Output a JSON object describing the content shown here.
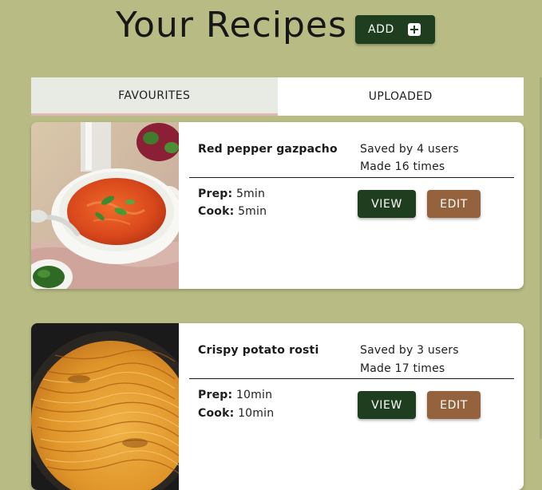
{
  "header": {
    "title": "Your Recipes",
    "add_label": "ADD",
    "add_icon": "plus-square-icon"
  },
  "tabs": [
    {
      "label": "FAVOURITES",
      "active": true
    },
    {
      "label": "UPLOADED",
      "active": false
    }
  ],
  "recipes": [
    {
      "name": "Red pepper gazpacho",
      "saved_by": "Saved by 4 users",
      "made": "Made 16 times",
      "prep_label": "Prep:",
      "prep_value": "5min",
      "cook_label": "Cook:",
      "cook_value": "5min",
      "view_label": "VIEW",
      "edit_label": "EDIT"
    },
    {
      "name": "Crispy potato rosti",
      "saved_by": "Saved by 3 users",
      "made": "Made 17 times",
      "prep_label": "Prep:",
      "prep_value": "10min",
      "cook_label": "Cook:",
      "cook_value": "10min",
      "view_label": "VIEW",
      "edit_label": "EDIT"
    }
  ],
  "colors": {
    "page_background": "#b8bc84",
    "primary_button": "#1f3d1f",
    "edit_button": "#94623d",
    "active_tab": "#e7ebe4",
    "active_tab_underline": "#e0b6b6",
    "card_background": "#ffffff"
  }
}
